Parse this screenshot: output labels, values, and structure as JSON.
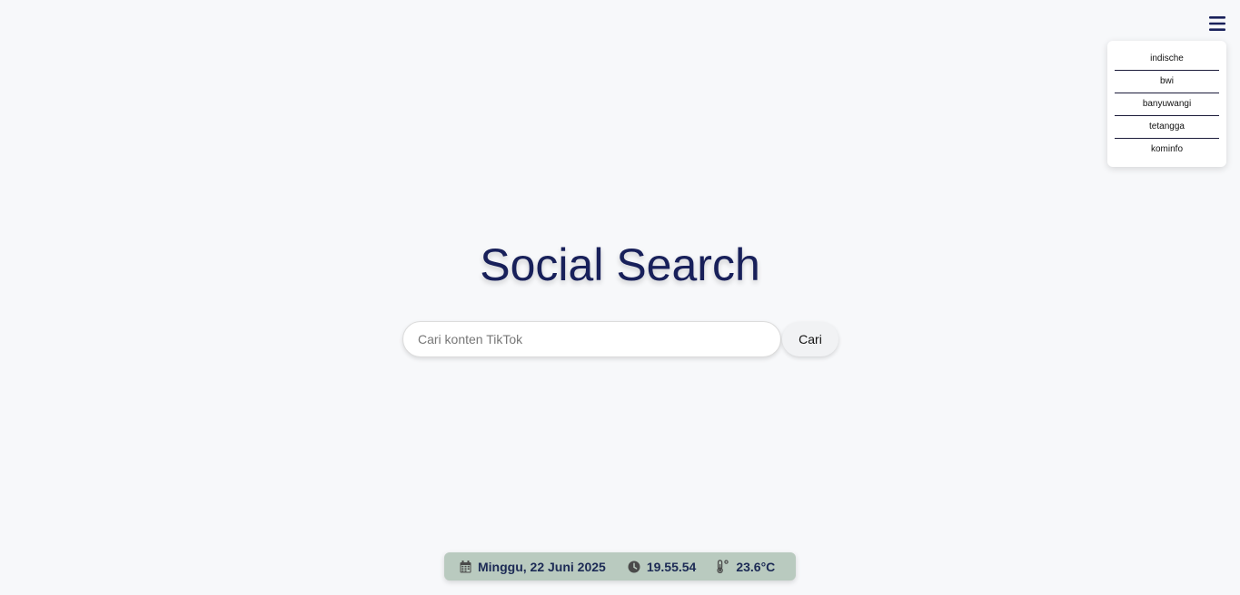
{
  "menu": {
    "items": [
      {
        "label": "indische"
      },
      {
        "label": "bwi"
      },
      {
        "label": "banyuwangi"
      },
      {
        "label": "tetangga"
      },
      {
        "label": "kominfo"
      }
    ]
  },
  "main": {
    "title": "Social Search",
    "search_placeholder": "Cari konten TikTok",
    "search_value": "",
    "search_button_label": "Cari"
  },
  "status": {
    "date": "Minggu, 22 Juni 2025",
    "time": "19.55.54",
    "temperature": "23.6°C",
    "icons": [
      "calendar-icon",
      "clock-icon",
      "thermometer-icon"
    ]
  },
  "colors": {
    "background": "#f7f8fa",
    "title": "#18205a",
    "status_bar": "#b9cabf",
    "status_text": "#1c2a55"
  }
}
